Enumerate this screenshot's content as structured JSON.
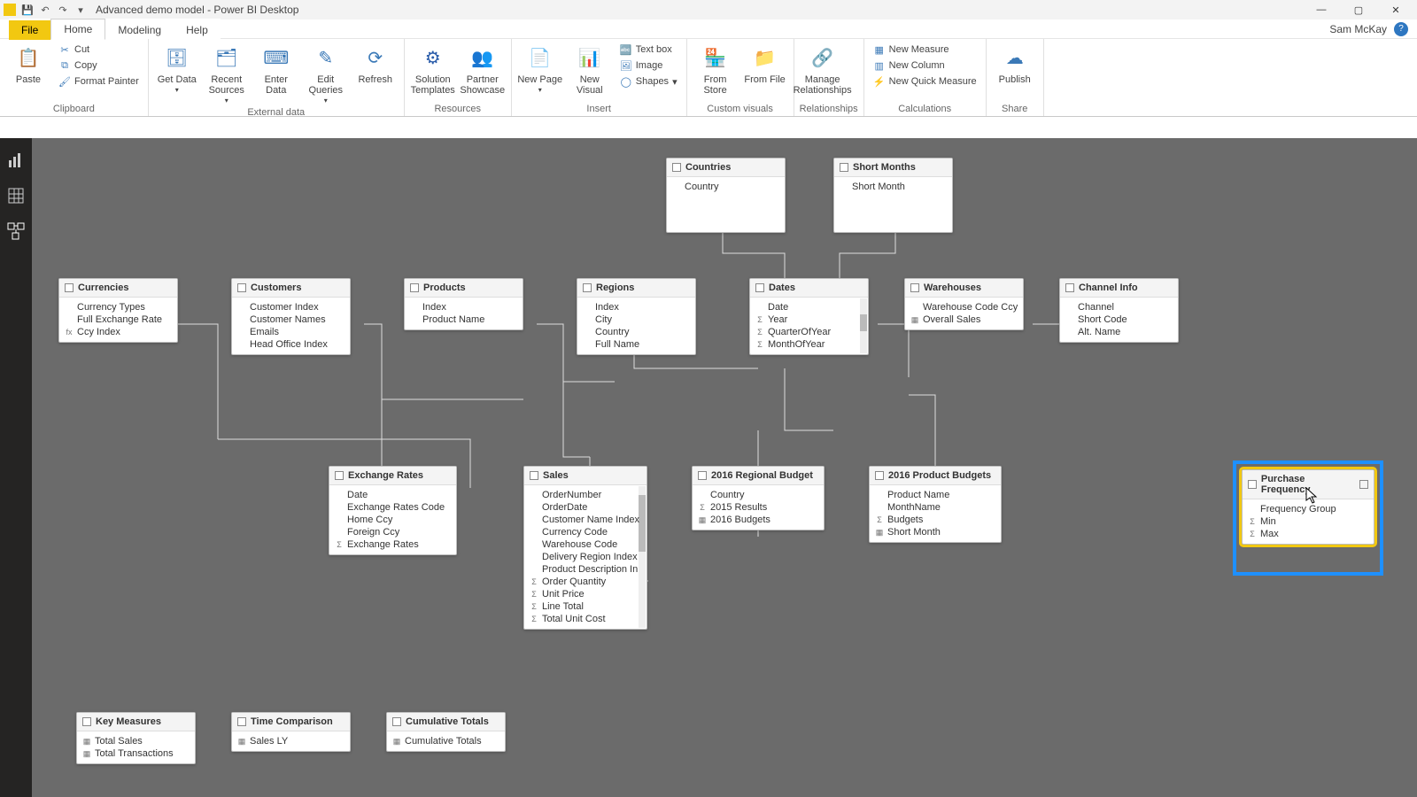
{
  "app": {
    "title": "Advanced demo model - Power BI Desktop",
    "user": "Sam McKay"
  },
  "tabs": {
    "file": "File",
    "home": "Home",
    "modeling": "Modeling",
    "help": "Help"
  },
  "ribbon": {
    "clipboard": {
      "label": "Clipboard",
      "paste": "Paste",
      "cut": "Cut",
      "copy": "Copy",
      "format_painter": "Format Painter"
    },
    "external": {
      "label": "External data",
      "get_data": "Get Data",
      "recent_sources": "Recent Sources",
      "enter_data": "Enter Data",
      "edit_queries": "Edit Queries",
      "refresh": "Refresh"
    },
    "resources": {
      "label": "Resources",
      "solution_templates": "Solution Templates",
      "partner_showcase": "Partner Showcase"
    },
    "insert": {
      "label": "Insert",
      "new_page": "New Page",
      "new_visual": "New Visual",
      "text_box": "Text box",
      "image": "Image",
      "shapes": "Shapes"
    },
    "custom": {
      "label": "Custom visuals",
      "from_store": "From Store",
      "from_file": "From File"
    },
    "relationships": {
      "label": "Relationships",
      "manage": "Manage Relationships"
    },
    "calculations": {
      "label": "Calculations",
      "new_measure": "New Measure",
      "new_column": "New Column",
      "new_quick_measure": "New Quick Measure"
    },
    "share": {
      "label": "Share",
      "publish": "Publish"
    }
  },
  "tables": {
    "countries": {
      "name": "Countries",
      "fields": [
        "Country"
      ]
    },
    "short_months": {
      "name": "Short Months",
      "fields": [
        "Short Month"
      ]
    },
    "currencies": {
      "name": "Currencies",
      "fields": [
        "Currency Types",
        "Full Exchange Rate",
        "Ccy Index"
      ],
      "icons": [
        "",
        "",
        "fx"
      ]
    },
    "customers": {
      "name": "Customers",
      "fields": [
        "Customer Index",
        "Customer Names",
        "Emails",
        "Head Office Index"
      ]
    },
    "products": {
      "name": "Products",
      "fields": [
        "Index",
        "Product Name"
      ]
    },
    "regions": {
      "name": "Regions",
      "fields": [
        "Index",
        "City",
        "Country",
        "Full Name"
      ]
    },
    "dates": {
      "name": "Dates",
      "fields": [
        "Date",
        "Year",
        "QuarterOfYear",
        "MonthOfYear"
      ],
      "icons": [
        "",
        "Σ",
        "Σ",
        "Σ"
      ]
    },
    "warehouses": {
      "name": "Warehouses",
      "fields": [
        "Warehouse Code Ccy",
        "Overall Sales"
      ],
      "icons": [
        "",
        "▦"
      ]
    },
    "channel_info": {
      "name": "Channel Info",
      "fields": [
        "Channel",
        "Short Code",
        "Alt. Name"
      ]
    },
    "exchange_rates": {
      "name": "Exchange Rates",
      "fields": [
        "Date",
        "Exchange Rates Code",
        "Home Ccy",
        "Foreign Ccy",
        "Exchange Rates"
      ],
      "icons": [
        "",
        "",
        "",
        "",
        "Σ"
      ]
    },
    "sales": {
      "name": "Sales",
      "fields": [
        "OrderNumber",
        "OrderDate",
        "Customer Name Index",
        "Currency Code",
        "Warehouse Code",
        "Delivery Region Index",
        "Product Description In",
        "Order Quantity",
        "Unit Price",
        "Line Total",
        "Total Unit Cost"
      ],
      "icons": [
        "",
        "",
        "",
        "",
        "",
        "",
        "",
        "Σ",
        "Σ",
        "Σ",
        "Σ"
      ]
    },
    "regional_budget": {
      "name": "2016 Regional Budget",
      "fields": [
        "Country",
        "2015 Results",
        "2016 Budgets"
      ],
      "icons": [
        "",
        "Σ",
        "▦"
      ]
    },
    "product_budgets": {
      "name": "2016 Product Budgets",
      "fields": [
        "Product Name",
        "MonthName",
        "Budgets",
        "Short Month"
      ],
      "icons": [
        "",
        "",
        "Σ",
        "▦"
      ]
    },
    "purchase_frequency": {
      "name": "Purchase Frequency",
      "fields": [
        "Frequency Group",
        "Min",
        "Max"
      ],
      "icons": [
        "",
        "Σ",
        "Σ"
      ]
    },
    "key_measures": {
      "name": "Key Measures",
      "fields": [
        "Total Sales",
        "Total Transactions"
      ],
      "icons": [
        "▦",
        "▦"
      ]
    },
    "time_comparison": {
      "name": "Time Comparison",
      "fields": [
        "Sales LY"
      ],
      "icons": [
        "▦"
      ]
    },
    "cumulative_totals": {
      "name": "Cumulative Totals",
      "fields": [
        "Cumulative Totals"
      ],
      "icons": [
        "▦"
      ]
    }
  }
}
